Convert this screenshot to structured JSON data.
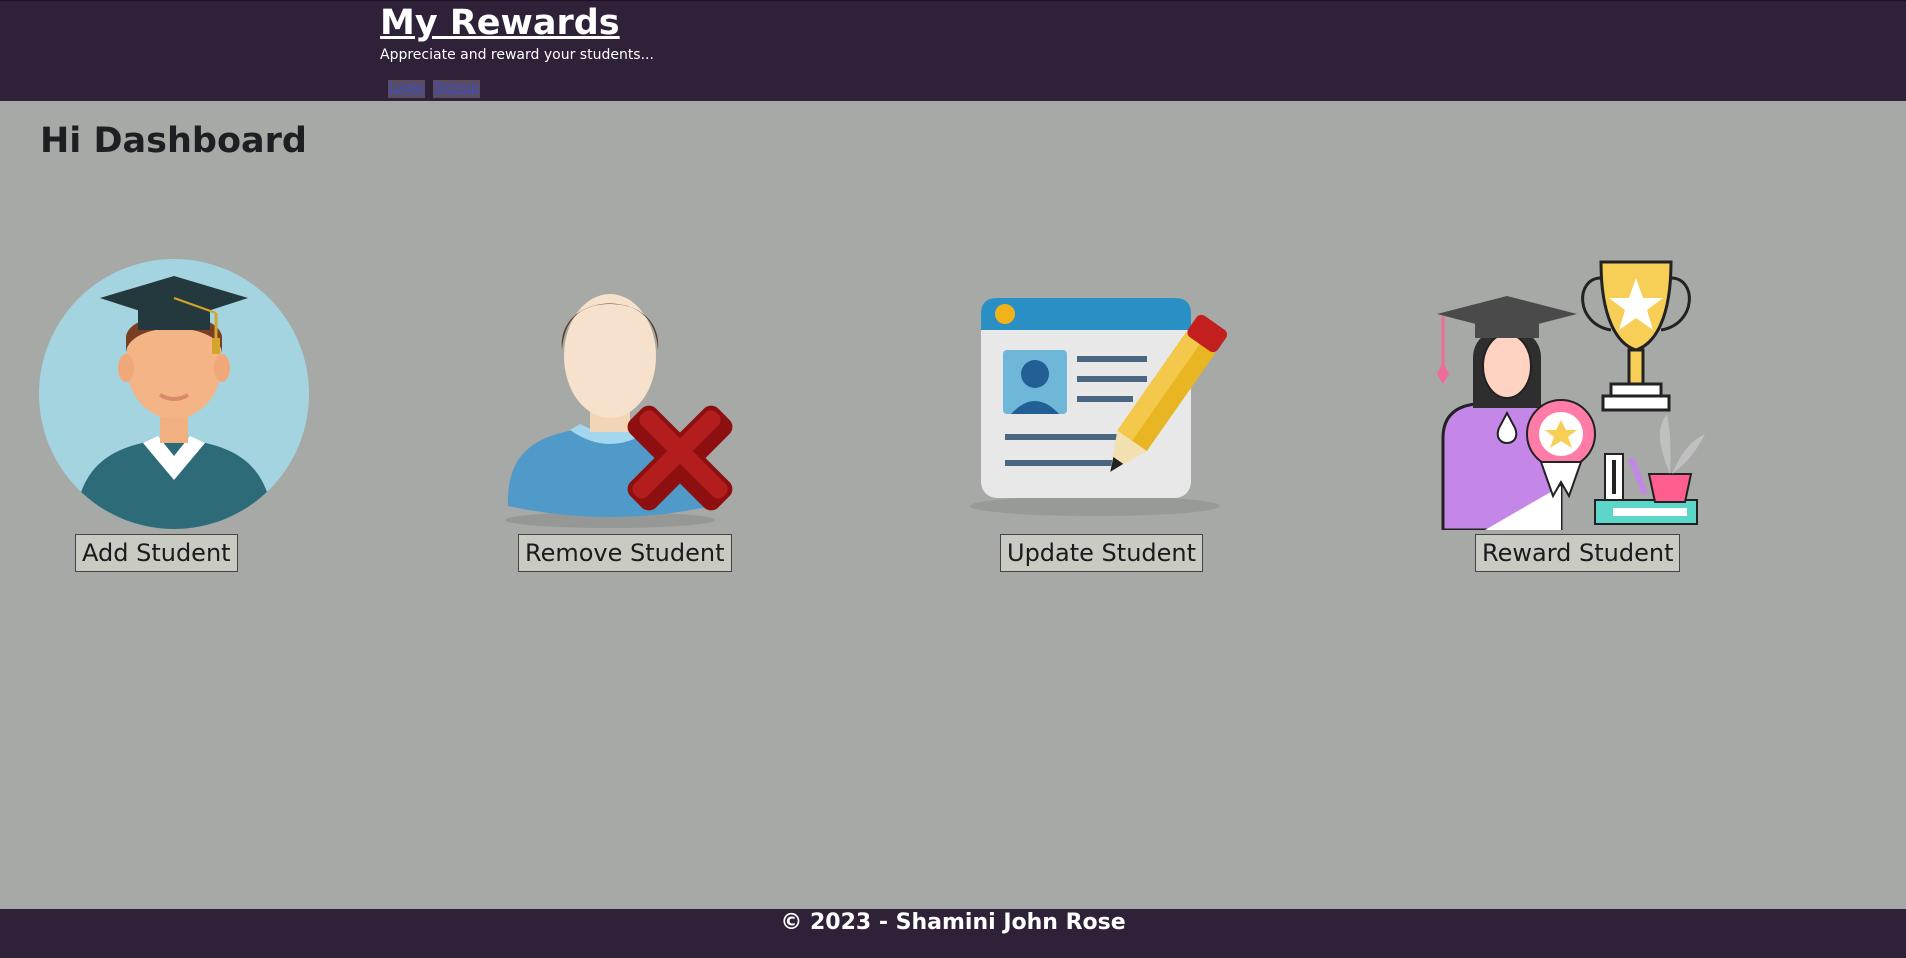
{
  "header": {
    "brand": "My Rewards",
    "tagline": "Appreciate and reward your students...",
    "nav": {
      "login": "Login",
      "signup": "Signup"
    }
  },
  "main": {
    "title": "Hi Dashboard",
    "cards": [
      {
        "label": "Add Student",
        "icon": "student-graduate-icon"
      },
      {
        "label": "Remove Student",
        "icon": "remove-user-icon"
      },
      {
        "label": "Update Student",
        "icon": "edit-id-card-icon"
      },
      {
        "label": "Reward Student",
        "icon": "graduate-trophy-icon"
      }
    ]
  },
  "footer": {
    "text": "© 2023 - Shamini John Rose"
  },
  "colors": {
    "header_bg": "#2e2138",
    "page_bg": "#a6a9a5",
    "button_bg": "#c9cbc3"
  }
}
